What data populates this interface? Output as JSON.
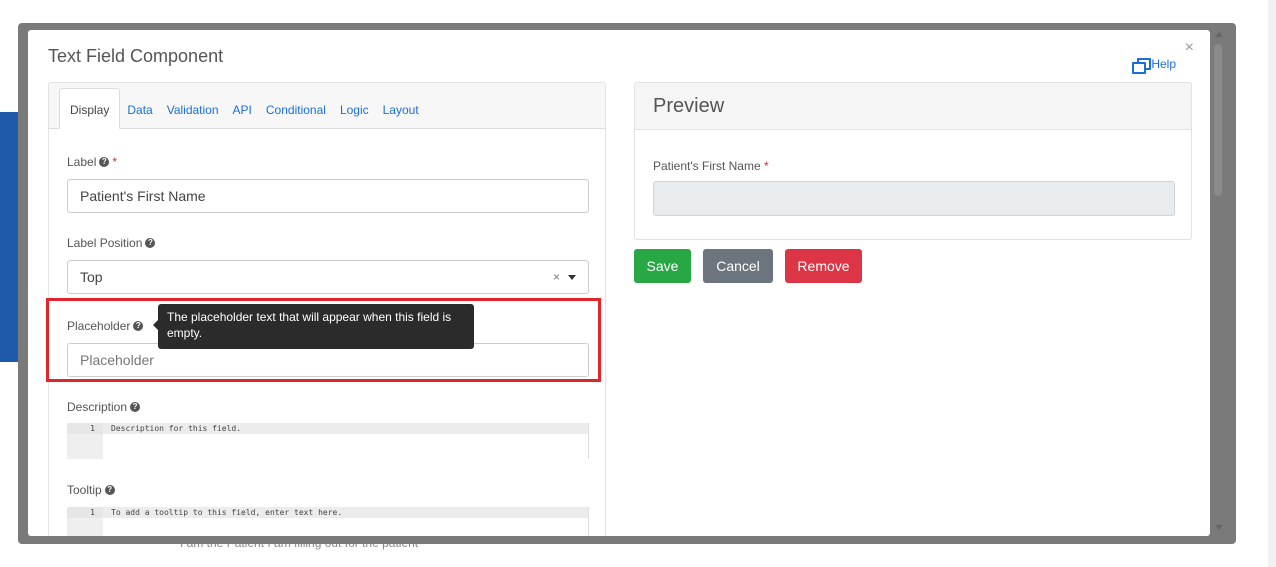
{
  "modal": {
    "title": "Text Field Component",
    "close_label": "×",
    "help_label": "Help"
  },
  "tabs": [
    {
      "label": "Display",
      "active": true
    },
    {
      "label": "Data"
    },
    {
      "label": "Validation"
    },
    {
      "label": "API"
    },
    {
      "label": "Conditional"
    },
    {
      "label": "Logic"
    },
    {
      "label": "Layout"
    }
  ],
  "form": {
    "label": {
      "label": "Label",
      "required_mark": "*",
      "value": "Patient's First Name"
    },
    "label_position": {
      "label": "Label Position",
      "value": "Top",
      "clear_label": "×"
    },
    "placeholder": {
      "label": "Placeholder",
      "placeholder": "Placeholder",
      "value": ""
    },
    "tooltip_popup": {
      "text": "The placeholder text that will appear when this field is empty."
    },
    "description": {
      "label": "Description",
      "line_number": "1",
      "code": "Description for this field."
    },
    "tooltip": {
      "label": "Tooltip",
      "line_number": "1",
      "code": "To add a tooltip to this field, enter text here."
    }
  },
  "preview": {
    "title": "Preview",
    "field_label": "Patient's First Name",
    "required_mark": "*"
  },
  "buttons": {
    "save": "Save",
    "cancel": "Cancel",
    "remove": "Remove"
  },
  "colors": {
    "link": "#1a6fd6",
    "save": "#28a745",
    "cancel": "#6c757d",
    "remove": "#dc3545",
    "highlight": "#e0262b"
  },
  "background": {
    "text": "I am the Patient    I am filling out for the patient"
  }
}
